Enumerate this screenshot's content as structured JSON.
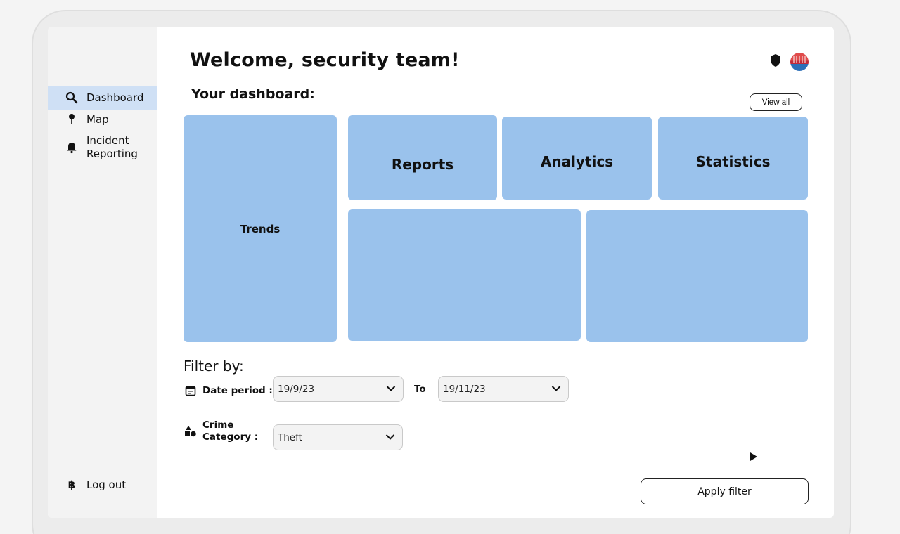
{
  "header": {
    "title": "Welcome, security team!",
    "subtitle": "Your dashboard:",
    "view_all_label": "View all"
  },
  "sidebar": {
    "items": [
      {
        "label": "Dashboard",
        "icon": "search-icon",
        "active": true
      },
      {
        "label": "Map",
        "icon": "pin-icon",
        "active": false
      },
      {
        "label": "Incident Reporting",
        "icon": "bell-icon",
        "active": false
      }
    ],
    "logout_label": "Log out",
    "logout_icon": "bitcoin-icon"
  },
  "tiles": {
    "trends": "Trends",
    "reports": "Reports",
    "analytics": "Analytics",
    "statistics": "Statistics"
  },
  "filters": {
    "title": "Filter by:",
    "date_label": "Date period :",
    "to_label": "To",
    "date_from": "19/9/23",
    "date_to": "19/11/23",
    "category_label_line1": "Crime",
    "category_label_line2": "Category :",
    "category_value": "Theft"
  },
  "actions": {
    "apply_label": "Apply filter"
  },
  "colors": {
    "tile": "#9ac2ec",
    "sidebar_active": "#cfe0f5",
    "sidebar_bg": "#f3f3f3"
  }
}
